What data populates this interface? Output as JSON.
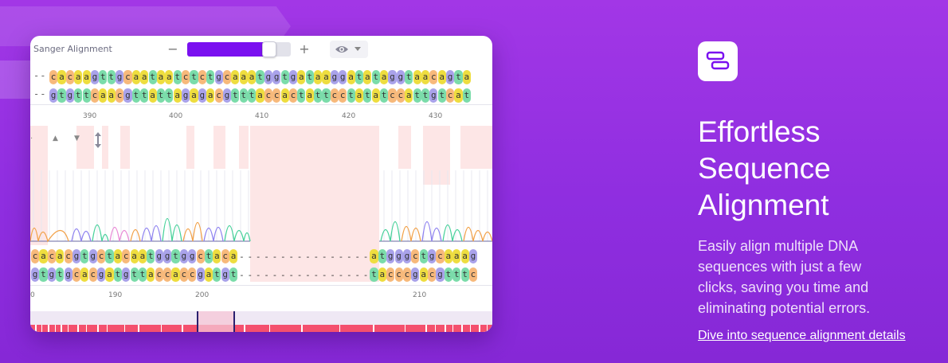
{
  "card": {
    "title": "Sanger Alignment",
    "zoom": {
      "minus_label": "−",
      "plus_label": "+",
      "level": 0.84
    },
    "ref_leading_gaps": "--",
    "ref_top": "cacaagttgcaataatctctgcaaatggtgataaggatataggtaacagta",
    "ref_bottom": "gtgttcaacgttattagagacgtttaccactattcctatatccattgtcat",
    "top_ruler": [
      "390",
      "400",
      "410",
      "420",
      "430"
    ],
    "read_top_left": "cacacgtgctacaatggtggctaca",
    "read_top_right": "atgggctgcaaag",
    "read_bottom_left": "gtgtgcacgatgttaccaccgatgt",
    "read_bottom_right": "tacccgacgtttc",
    "gap_count": 16,
    "bottom_ruler": [
      "0",
      "190",
      "200",
      "210"
    ],
    "base_colors": {
      "a": "#eedd3f",
      "c": "#f7b97b",
      "g": "#a9a2ea",
      "t": "#7bdcaa"
    }
  },
  "feature": {
    "icon": "alignment-bars-icon",
    "headline": [
      "Effortless",
      "Sequence",
      "Alignment"
    ],
    "description": [
      "Easily align multiple DNA",
      "sequences with just a few",
      "clicks, saving you time and",
      "eliminating potential errors."
    ],
    "link": "Dive into sequence alignment details"
  }
}
